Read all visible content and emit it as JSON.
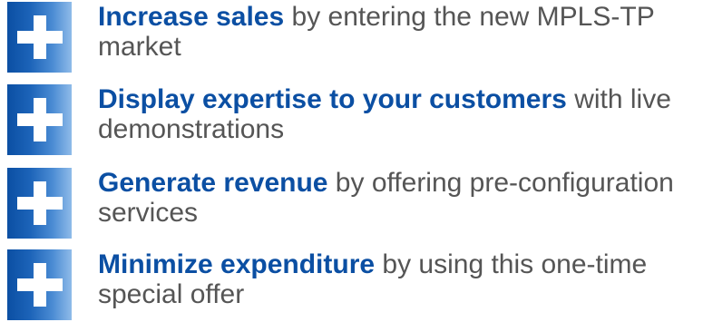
{
  "benefits": [
    {
      "icon": "plus-icon",
      "headline": "Increase sales",
      "detail": " by entering the new MPLS-TP market"
    },
    {
      "icon": "plus-icon",
      "headline": "Display expertise to your customers",
      "detail": " with live demonstrations"
    },
    {
      "icon": "plus-icon",
      "headline": "Generate revenue",
      "detail": " by offering pre-configuration services"
    },
    {
      "icon": "plus-icon",
      "headline": "Minimize expenditure",
      "detail": "  by using this one-time special offer"
    }
  ],
  "colors": {
    "headline": "#0b4fa3",
    "body_text": "#555555",
    "icon_gradient_start": "#0b4fa3",
    "icon_gradient_end": "#8fbbe9",
    "icon_cross": "#ffffff"
  }
}
